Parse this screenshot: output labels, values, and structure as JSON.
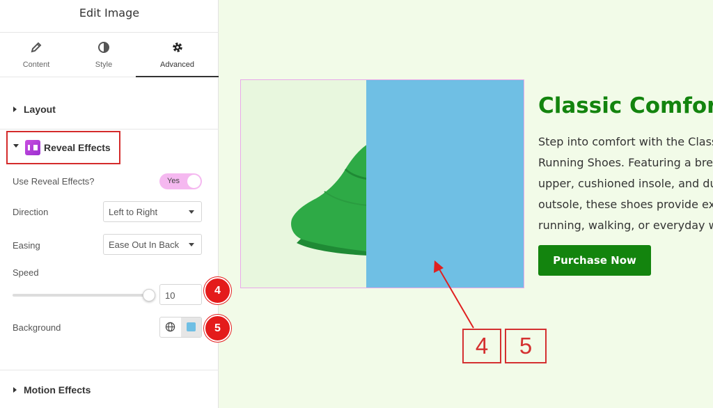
{
  "panel": {
    "title": "Edit Image",
    "tabs": [
      {
        "label": "Content",
        "icon": "pencil-icon"
      },
      {
        "label": "Style",
        "icon": "contrast-icon"
      },
      {
        "label": "Advanced",
        "icon": "gear-icon"
      }
    ],
    "active_tab": "Advanced",
    "sections": {
      "layout": "Layout",
      "reveal": "Reveal Effects",
      "motion": "Motion Effects"
    },
    "controls": {
      "use_reveal_label": "Use Reveal Effects?",
      "use_reveal_value": "Yes",
      "direction_label": "Direction",
      "direction_value": "Left to Right",
      "easing_label": "Easing",
      "easing_value": "Ease Out In Back",
      "speed_label": "Speed",
      "speed_value": "10",
      "background_label": "Background",
      "background_color": "#6fbfe4"
    },
    "badges": [
      "4",
      "5"
    ]
  },
  "preview": {
    "heading": "Classic Comfort",
    "body_lines": [
      "Step into comfort with the Classic",
      "Running Shoes. Featuring a brea",
      "upper, cushioned insole, and du",
      "outsole, these shoes provide exc",
      "running, walking, or everyday we"
    ],
    "button": "Purchase Now",
    "callouts": [
      "4",
      "5"
    ]
  },
  "colors": {
    "accent_green": "#13840e",
    "reveal_overlay": "#6fbfe4",
    "badge_red": "#e41b1b",
    "toggle_pink": "#f5b8f0",
    "shoe_green": "#2eaa46"
  }
}
